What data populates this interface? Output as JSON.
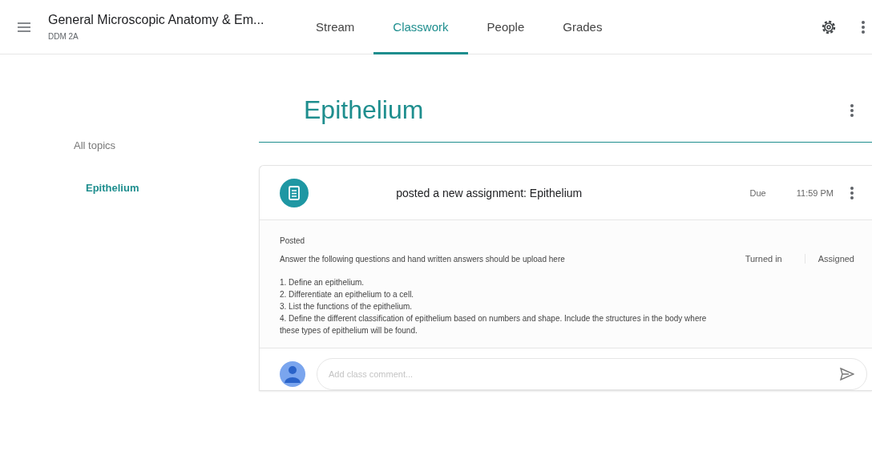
{
  "header": {
    "course_title": "General Microscopic Anatomy & Em...",
    "section": "DDM 2A"
  },
  "tabs": [
    {
      "label": "Stream",
      "selected": false
    },
    {
      "label": "Classwork",
      "selected": true
    },
    {
      "label": "People",
      "selected": false
    },
    {
      "label": "Grades",
      "selected": false
    }
  ],
  "sidebar": {
    "items": [
      {
        "label": "All topics",
        "selected": false
      },
      {
        "label": "Epithelium",
        "selected": true
      }
    ]
  },
  "topic": {
    "title": "Epithelium"
  },
  "assignment": {
    "headline": "posted a new assignment: Epithelium",
    "due_label": "Due",
    "due_time": "11:59 PM",
    "posted": "Posted",
    "instructions": "Answer the following questions and  hand written answers should be upload here",
    "stats": [
      "Turned in",
      "Assigned"
    ],
    "questions": [
      "1. Define an epithelium.",
      "2. Differentiate an epithelium to a cell.",
      "3. List the functions of the epithelium.",
      "4. Define the different classification of epithelium based on numbers and shape. Include the structures in the body where these types of epithelium will be found."
    ],
    "comment": {
      "placeholder": "Add class comment..."
    }
  }
}
